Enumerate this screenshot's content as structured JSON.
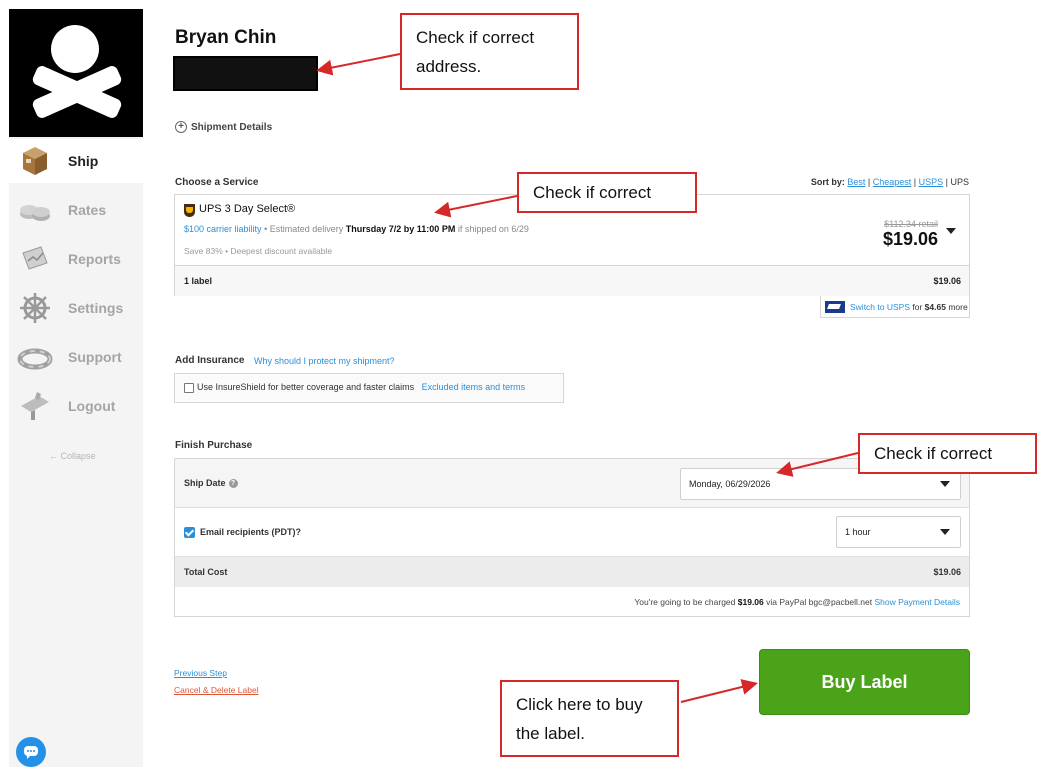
{
  "sidebar": {
    "items": [
      {
        "label": "Ship",
        "icon": "package-icon",
        "active": true
      },
      {
        "label": "Rates",
        "icon": "coins-icon",
        "active": false
      },
      {
        "label": "Reports",
        "icon": "reports-icon",
        "active": false
      },
      {
        "label": "Settings",
        "icon": "ship-wheel-icon",
        "active": false
      },
      {
        "label": "Support",
        "icon": "life-ring-icon",
        "active": false
      },
      {
        "label": "Logout",
        "icon": "logout-icon",
        "active": false
      }
    ],
    "collapse": "← Collapse"
  },
  "recipient": {
    "name": "Bryan Chin"
  },
  "shipment_details": "Shipment Details",
  "service": {
    "section_title": "Choose a Service",
    "sort": {
      "label": "Sort by:",
      "options": [
        "Best",
        "Cheapest",
        "USPS",
        "UPS"
      ]
    },
    "name": "UPS 3 Day Select®",
    "liability": "$100 carrier liability",
    "est_prefix": "• Estimated delivery",
    "est_date": "Thursday 7/2 by 11:00 PM",
    "est_suffix": "if shipped on 6/29",
    "savings": "Save 83% • Deepest discount available",
    "retail": "$112.34 retail",
    "price": "$19.06",
    "label_count": "1 label",
    "label_price": "$19.06"
  },
  "usps_switch": {
    "link": "Switch to USPS",
    "for": "for",
    "amount": "$4.65",
    "more": "more"
  },
  "insurance": {
    "title": "Add Insurance",
    "why_link": "Why should I protect my shipment?",
    "checkbox_label": "Use InsureShield for better coverage and faster claims",
    "excluded_link": "Excluded items and terms"
  },
  "finish": {
    "title": "Finish Purchase",
    "ship_date_label": "Ship Date",
    "ship_date_value": "Monday, 06/29/2026",
    "email_label": "Email recipients (PDT)?",
    "email_value": "1 hour",
    "total_label": "Total Cost",
    "total_value": "$19.06",
    "charge_prefix": "You're going to be charged",
    "charge_amount": "$19.06",
    "charge_via": "via PayPal bgc@pacbell.net",
    "payment_link": "Show Payment Details"
  },
  "footer": {
    "previous_step": "Previous Step",
    "cancel_delete": "Cancel & Delete Label",
    "buy_label": "Buy Label"
  },
  "callouts": {
    "address": "Check if correct address.",
    "service": "Check if correct",
    "date": "Check if correct",
    "buy": "Click here to buy the label."
  },
  "colors": {
    "accent_blue": "#2a8fd8",
    "buy_green": "#4aa319",
    "callout_red": "#d62828"
  }
}
